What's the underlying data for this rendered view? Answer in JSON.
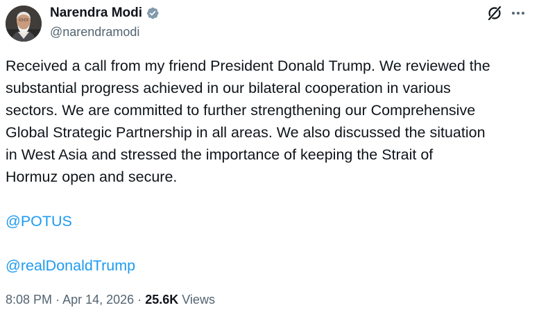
{
  "author": {
    "display_name": "Narendra Modi",
    "handle": "@narendramodi",
    "verified_badge_color": "#829aab",
    "avatar_icon": "profile-photo"
  },
  "icons": {
    "grok": "grok-icon",
    "more": "more-icon"
  },
  "tweet": {
    "text": "Received a call from my friend President Donald Trump. We reviewed the\nsubstantial progress achieved in our bilateral cooperation in various\nsectors. We are committed to further strengthening our Comprehensive\nGlobal Strategic Partnership in all areas. We also discussed the situation\nin West Asia and stressed the importance of keeping the Strait of\nHormuz open and secure.",
    "mentions": [
      "@POTUS",
      "@realDonaldTrump"
    ]
  },
  "meta": {
    "time": "8:08 PM",
    "separator": "·",
    "date": "Apr 14, 2026",
    "views_count": "25.6K",
    "views_label": "Views"
  },
  "colors": {
    "text_primary": "#0f1419",
    "text_secondary": "#536471",
    "link": "#1d9bf0",
    "background": "#ffffff"
  }
}
